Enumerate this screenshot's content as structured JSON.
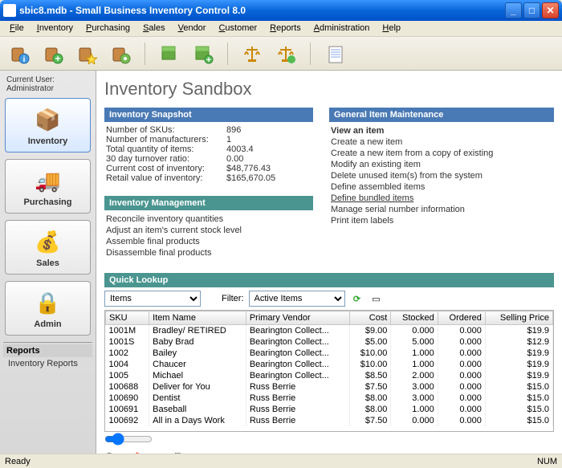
{
  "title": "sbic8.mdb - Small Business Inventory Control 8.0",
  "menu": [
    "File",
    "Inventory",
    "Purchasing",
    "Sales",
    "Vendor",
    "Customer",
    "Reports",
    "Administration",
    "Help"
  ],
  "sidebar": {
    "current_user": "Current User: Administrator",
    "nav": [
      {
        "label": "Inventory"
      },
      {
        "label": "Purchasing"
      },
      {
        "label": "Sales"
      },
      {
        "label": "Admin"
      }
    ],
    "reports_header": "Reports",
    "reports_item": "Inventory Reports"
  },
  "page_title": "Inventory Sandbox",
  "snapshot": {
    "header": "Inventory Snapshot",
    "rows": [
      {
        "label": "Number of SKUs:",
        "value": "896"
      },
      {
        "label": "Number of manufacturers:",
        "value": "1"
      },
      {
        "label": "Total quantity of items:",
        "value": "4003.4"
      },
      {
        "label": "30 day turnover ratio:",
        "value": "0.00"
      },
      {
        "label": "Current cost of inventory:",
        "value": "$48,776.43"
      },
      {
        "label": "Retail value of inventory:",
        "value": "$165,670.05"
      }
    ]
  },
  "gim": {
    "header": "General Item Maintenance",
    "items": [
      "View an item",
      "Create a new item",
      "Create a new item from a copy of existing",
      "Modify an existing item",
      "Delete unused item(s) from the system",
      "Define assembled items",
      "Define bundled items",
      "Manage serial number information",
      "Print item labels"
    ]
  },
  "inv_mgmt": {
    "header": "Inventory Management",
    "items": [
      "Reconcile inventory quantities",
      "Adjust an item's current stock level",
      "Assemble final products",
      "Disassemble final products"
    ]
  },
  "quick_lookup": {
    "header": "Quick Lookup",
    "select1": "Items",
    "filter_label": "Filter:",
    "select2": "Active Items",
    "columns": [
      "SKU",
      "Item Name",
      "Primary Vendor",
      "Cost",
      "Stocked",
      "Ordered",
      "Selling Price"
    ],
    "rows": [
      {
        "sku": "1001M",
        "name": "Bradley/ RETIRED",
        "vendor": "Bearington Collect...",
        "cost": "$9.00",
        "stocked": "0.000",
        "ordered": "0.000",
        "price": "$19.9"
      },
      {
        "sku": "1001S",
        "name": "Baby Brad",
        "vendor": "Bearington Collect...",
        "cost": "$5.00",
        "stocked": "5.000",
        "ordered": "0.000",
        "price": "$12.9"
      },
      {
        "sku": "1002",
        "name": "Bailey",
        "vendor": "Bearington Collect...",
        "cost": "$10.00",
        "stocked": "1.000",
        "ordered": "0.000",
        "price": "$19.9"
      },
      {
        "sku": "1004",
        "name": "Chaucer",
        "vendor": "Bearington Collect...",
        "cost": "$10.00",
        "stocked": "1.000",
        "ordered": "0.000",
        "price": "$19.9"
      },
      {
        "sku": "1005",
        "name": "Michael",
        "vendor": "Bearington Collect...",
        "cost": "$8.50",
        "stocked": "2.000",
        "ordered": "0.000",
        "price": "$19.9"
      },
      {
        "sku": "100688",
        "name": "Deliver for You",
        "vendor": "Russ Berrie",
        "cost": "$7.50",
        "stocked": "3.000",
        "ordered": "0.000",
        "price": "$15.0"
      },
      {
        "sku": "100690",
        "name": "Dentist",
        "vendor": "Russ Berrie",
        "cost": "$8.00",
        "stocked": "3.000",
        "ordered": "0.000",
        "price": "$15.0"
      },
      {
        "sku": "100691",
        "name": "Baseball",
        "vendor": "Russ Berrie",
        "cost": "$8.00",
        "stocked": "1.000",
        "ordered": "0.000",
        "price": "$15.0"
      },
      {
        "sku": "100692",
        "name": "All in a Days Work",
        "vendor": "Russ Berrie",
        "cost": "$7.50",
        "stocked": "0.000",
        "ordered": "0.000",
        "price": "$15.0"
      }
    ]
  },
  "status": {
    "left": "Ready",
    "right": "NUM"
  }
}
